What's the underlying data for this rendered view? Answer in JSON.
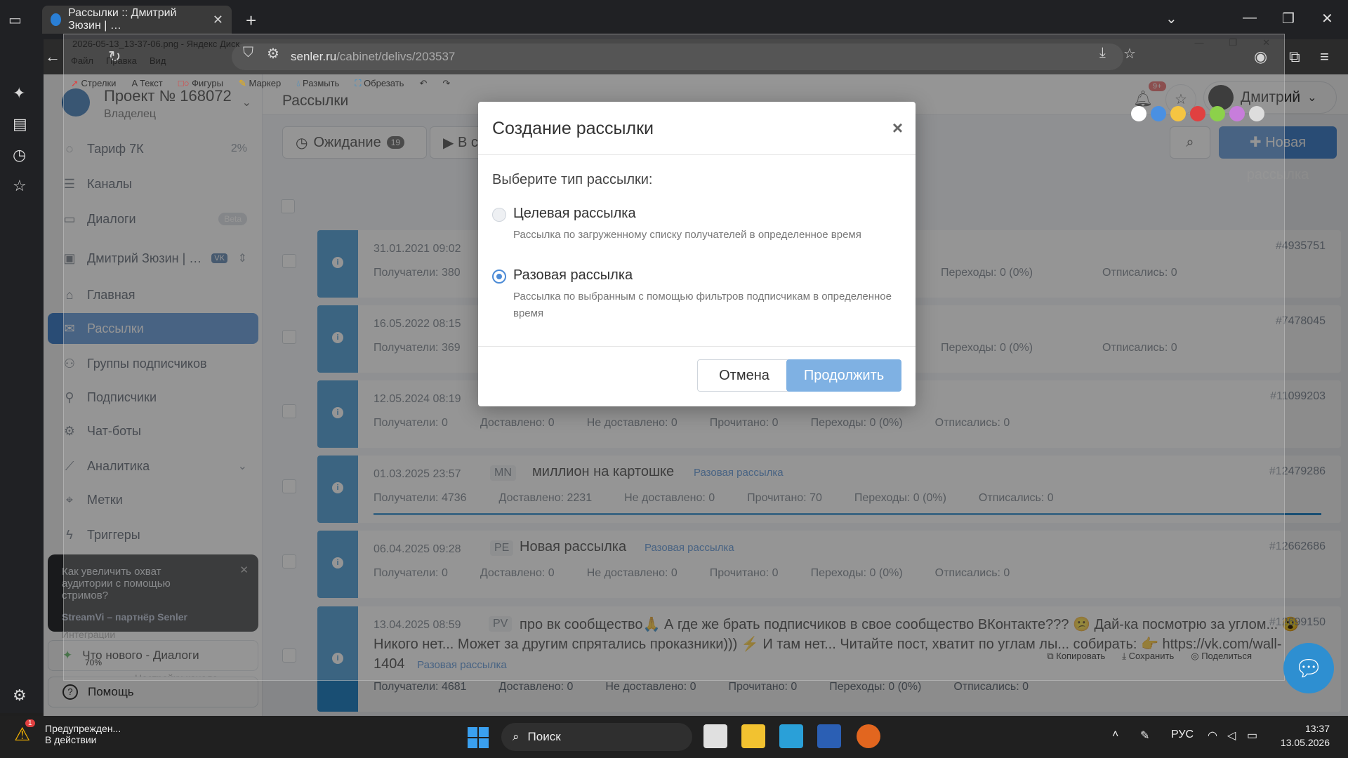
{
  "browser": {
    "tab_title": "Рассылки :: Дмитрий Зюзин | …",
    "url_host": "senler.ru",
    "url_path": "/cabinet/delivs/203537"
  },
  "viewer": {
    "title": "2026-05-13_13-37-06.png - Яндекс Диск",
    "menu": [
      "Файл",
      "Правка",
      "Вид"
    ],
    "tools": [
      "Стрелки",
      "Текст",
      "Фигуры",
      "Маркер",
      "Размыть",
      "Обрезать"
    ],
    "footer": [
      "Копировать",
      "Сохранить",
      "Поделиться"
    ],
    "zoom": "70%",
    "swatch_colors": [
      "#ffffff",
      "#4a90e2",
      "#f5c542",
      "#e04040",
      "#8cd14a",
      "#c77ddb",
      "#dddddd"
    ]
  },
  "project": {
    "title": "Проект № 168072",
    "role": "Владелец"
  },
  "sidebar": {
    "tariff": {
      "label": "Тариф 7К",
      "value": "2%"
    },
    "channels": "Каналы",
    "dialogs": {
      "label": "Диалоги",
      "badge": "Beta"
    },
    "group": {
      "label": "Дмитрий Зюзин | …",
      "badge": "VK"
    },
    "items": [
      {
        "label": "Главная",
        "icon": "home-icon"
      },
      {
        "label": "Рассылки",
        "icon": "mail-icon"
      },
      {
        "label": "Группы подписчиков",
        "icon": "users-icon"
      },
      {
        "label": "Подписчики",
        "icon": "user-icon"
      },
      {
        "label": "Чат-боты",
        "icon": "bot-icon"
      },
      {
        "label": "Аналитика",
        "icon": "chart-icon"
      },
      {
        "label": "Метки",
        "icon": "tag-icon"
      },
      {
        "label": "Триггеры",
        "icon": "bolt-icon"
      }
    ],
    "promo": {
      "text": "Как увеличить охват аудитории с помощью стримов?",
      "partner": "StreamVi – партнёр Senler"
    },
    "hidden_items": [
      "Интеграции",
      "Настройки канала"
    ],
    "whats_new": "Что нового - Диалоги",
    "help": "Помощь"
  },
  "topbar": {
    "title": "Рассылки",
    "notifications": "9+",
    "user": "Дмитрий"
  },
  "toolbar": {
    "waiting_label": "Ожидание",
    "waiting_count": "19",
    "second_tab": "В с",
    "new_button": "Новая рассылка"
  },
  "rows": [
    {
      "date": "31.01.2021 09:02",
      "code": "",
      "title": "",
      "type": "",
      "id": "#4935751",
      "recipients": "Получатели: 380",
      "delivered": "",
      "not_delivered": "",
      "read": "",
      "clicks": "Переходы: 0 (0%)",
      "unsub": "Отписались: 0"
    },
    {
      "date": "16.05.2022 08:15",
      "code": "",
      "title": "",
      "type": "",
      "id": "#7478045",
      "recipients": "Получатели: 369",
      "delivered": "",
      "not_delivered": "",
      "read": "",
      "clicks": "Переходы: 0 (0%)",
      "unsub": "Отписались: 0"
    },
    {
      "date": "12.05.2024 08:19",
      "code": "",
      "title": "",
      "type": "",
      "id": "#11099203",
      "recipients": "Получатели: 0",
      "delivered": "Доставлено: 0",
      "not_delivered": "Не доставлено: 0",
      "read": "Прочитано: 0",
      "clicks": "Переходы: 0 (0%)",
      "unsub": "Отписались: 0"
    },
    {
      "date": "01.03.2025 23:57",
      "code": "MN",
      "title": "миллион на картошке",
      "type": "Разовая рассылка",
      "id": "#12479286",
      "recipients": "Получатели: 4736",
      "delivered": "Доставлено: 2231",
      "not_delivered": "Не доставлено: 0",
      "read": "Прочитано: 70",
      "clicks": "Переходы: 0 (0%)",
      "unsub": "Отписались: 0"
    },
    {
      "date": "06.04.2025 09:28",
      "code": "PE",
      "title": "Новая рассылка",
      "type": "Разовая рассылка",
      "id": "#12662686",
      "recipients": "Получатели: 0",
      "delivered": "Доставлено: 0",
      "not_delivered": "Не доставлено: 0",
      "read": "Прочитано: 0",
      "clicks": "Переходы: 0 (0%)",
      "unsub": "Отписались: 0"
    },
    {
      "date": "13.04.2025 08:59",
      "code": "PV",
      "title": "про вк сообщество🙏 А где же брать подписчиков в свое сообщество ВКонтакте??? 😕 Дай-ка посмотрю за углом... 😮 Никого нет... Может за другим спрятались проказники))) ⚡ И там нет... Читайте пост, хватит по углам лы... собирать: 👉 https://vk.com/wall-1404",
      "type": "Разовая рассылка",
      "id": "#12699150",
      "recipients": "Получатели: 4681",
      "delivered": "Доставлено: 0",
      "not_delivered": "Не доставлено: 0",
      "read": "Прочитано: 0",
      "clicks": "Переходы: 0 (0%)",
      "unsub": "Отписались: 0"
    }
  ],
  "modal": {
    "title": "Создание рассылки",
    "subtitle": "Выберите тип рассылки:",
    "options": [
      {
        "label": "Целевая рассылка",
        "desc": "Рассылка по загруженному списку получателей в определенное время",
        "selected": false
      },
      {
        "label": "Разовая рассылка",
        "desc": "Рассылка по выбранным с помощью фильтров подписчикам в определенное время",
        "selected": true
      }
    ],
    "cancel": "Отмена",
    "continue": "Продолжить"
  },
  "taskbar": {
    "warning_title": "Предупрежден...",
    "warning_sub": "В действии",
    "warning_count": "1",
    "search": "Поиск",
    "lang": "РУС",
    "time": "13:37",
    "date": "13.05.2026"
  }
}
